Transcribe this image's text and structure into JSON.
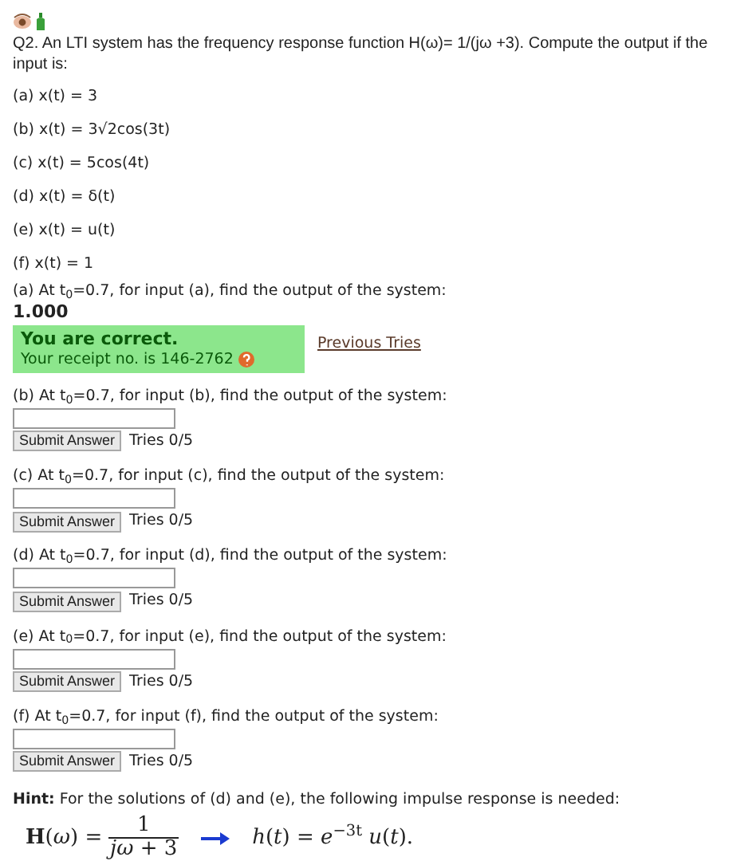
{
  "question": "Q2. An LTI system has the frequency response function H(ω)= 1/(jω +3). Compute the output if the input is:",
  "inputs": [
    "(a) x(t) = 3",
    "(b) x(t) = 3√2cos(3t)",
    "(c) x(t) = 5cos(4t)",
    "(d) x(t) = δ(t)",
    "(e) x(t) = u(t)",
    "(f) x(t) = 1"
  ],
  "parts": [
    {
      "kind": "answered",
      "prompt": "(a) At t$_{0}$=0.7, for input (a), find the output of the system:",
      "answer": "1.000",
      "feedback_title": "You are correct.",
      "feedback_text": "Your receipt no. is 146-2762",
      "link": "Previous Tries"
    },
    {
      "kind": "open",
      "prompt": "(b) At t$_{0}$=0.7, for input (b), find the output of the system:",
      "button": "Submit Answer",
      "tries": "Tries 0/5"
    },
    {
      "kind": "open",
      "prompt": "(c) At t$_{0}$=0.7, for input (c), find the output of the system:",
      "button": "Submit Answer",
      "tries": "Tries 0/5"
    },
    {
      "kind": "open",
      "prompt": "(d) At t$_{0}$=0.7, for input (d), find the output of the system:",
      "button": "Submit Answer",
      "tries": "Tries 0/5"
    },
    {
      "kind": "open",
      "prompt": "(e) At t$_{0}$=0.7, for input (e), find the output of the system:",
      "button": "Submit Answer",
      "tries": "Tries 0/5"
    },
    {
      "kind": "open",
      "prompt": "(f) At t$_{0}$=0.7, for input (f), find the output of the system:",
      "button": "Submit Answer",
      "tries": "Tries 0/5"
    }
  ],
  "hint": {
    "text": "**Hint:** For the solutions of (d) and (e), the following impulse response is needed:",
    "lhs": "**H**(*ω*) =",
    "numerator": "1",
    "denominator": "*jω* + 3",
    "rhs": "*h*(*t*) = *e*$^{−3t}$ *u*(*t*)."
  }
}
